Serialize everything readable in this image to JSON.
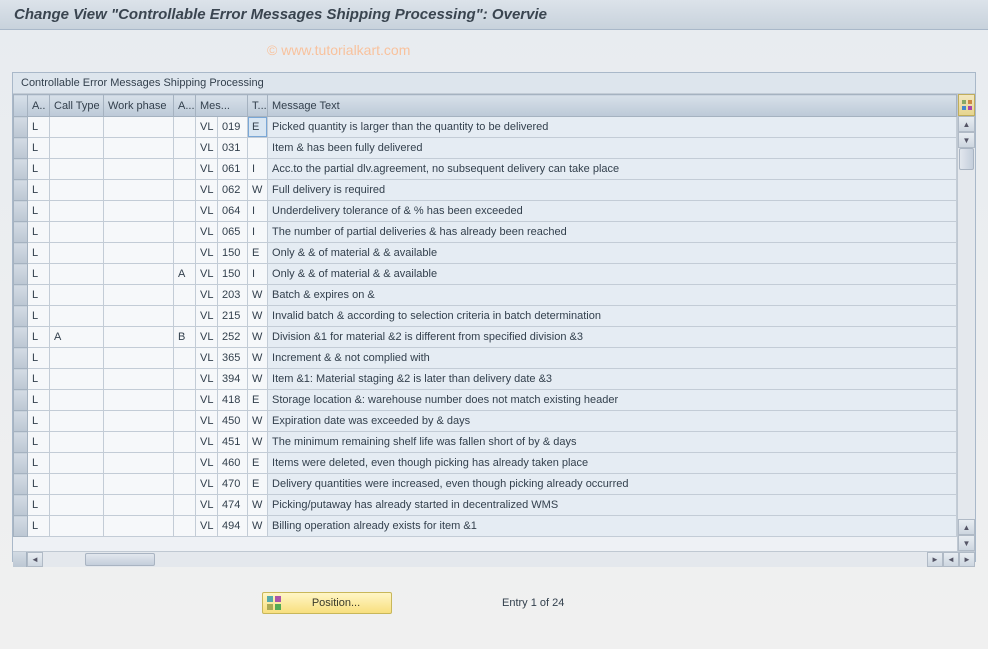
{
  "title": "Change View \"Controllable Error Messages Shipping Processing\": Overvie",
  "watermark": "© www.tutorialkart.com",
  "group_title": "Controllable Error Messages Shipping Processing",
  "columns": {
    "a1": "A..",
    "call_type": "Call Type",
    "work_phase": "Work phase",
    "a2": "A...",
    "mes_area": "Mes...",
    "t": "T...",
    "msg_text": "Message Text"
  },
  "rows": [
    {
      "a1": "L",
      "ct": "",
      "wp": "",
      "a2": "",
      "ma": "VL",
      "mn": "019",
      "t": "E",
      "txt": "Picked quantity is larger than the quantity to be delivered",
      "hl": true
    },
    {
      "a1": "L",
      "ct": "",
      "wp": "",
      "a2": "",
      "ma": "VL",
      "mn": "031",
      "t": "",
      "txt": "Item & has been fully delivered"
    },
    {
      "a1": "L",
      "ct": "",
      "wp": "",
      "a2": "",
      "ma": "VL",
      "mn": "061",
      "t": "I",
      "txt": "Acc.to the partial dlv.agreement, no subsequent delivery can take place"
    },
    {
      "a1": "L",
      "ct": "",
      "wp": "",
      "a2": "",
      "ma": "VL",
      "mn": "062",
      "t": "W",
      "txt": "Full delivery is required"
    },
    {
      "a1": "L",
      "ct": "",
      "wp": "",
      "a2": "",
      "ma": "VL",
      "mn": "064",
      "t": "I",
      "txt": "Underdelivery tolerance of & % has been exceeded"
    },
    {
      "a1": "L",
      "ct": "",
      "wp": "",
      "a2": "",
      "ma": "VL",
      "mn": "065",
      "t": "I",
      "txt": "The number of partial deliveries & has already been reached"
    },
    {
      "a1": "L",
      "ct": "",
      "wp": "",
      "a2": "",
      "ma": "VL",
      "mn": "150",
      "t": "E",
      "txt": "Only & & of material & & available"
    },
    {
      "a1": "L",
      "ct": "",
      "wp": "",
      "a2": "A",
      "ma": "VL",
      "mn": "150",
      "t": "I",
      "txt": "Only & & of material & & available"
    },
    {
      "a1": "L",
      "ct": "",
      "wp": "",
      "a2": "",
      "ma": "VL",
      "mn": "203",
      "t": "W",
      "txt": "Batch & expires on &"
    },
    {
      "a1": "L",
      "ct": "",
      "wp": "",
      "a2": "",
      "ma": "VL",
      "mn": "215",
      "t": "W",
      "txt": "Invalid batch & according to selection criteria in batch determination"
    },
    {
      "a1": "L",
      "ct": "A",
      "wp": "",
      "a2": "B",
      "ma": "VL",
      "mn": "252",
      "t": "W",
      "txt": "Division &1 for material &2 is different from specified division &3"
    },
    {
      "a1": "L",
      "ct": "",
      "wp": "",
      "a2": "",
      "ma": "VL",
      "mn": "365",
      "t": "W",
      "txt": "Increment & & not complied with"
    },
    {
      "a1": "L",
      "ct": "",
      "wp": "",
      "a2": "",
      "ma": "VL",
      "mn": "394",
      "t": "W",
      "txt": "Item &1: Material staging &2 is later than delivery date &3"
    },
    {
      "a1": "L",
      "ct": "",
      "wp": "",
      "a2": "",
      "ma": "VL",
      "mn": "418",
      "t": "E",
      "txt": "Storage location &: warehouse number does not match existing header"
    },
    {
      "a1": "L",
      "ct": "",
      "wp": "",
      "a2": "",
      "ma": "VL",
      "mn": "450",
      "t": "W",
      "txt": "Expiration date was exceeded by & days"
    },
    {
      "a1": "L",
      "ct": "",
      "wp": "",
      "a2": "",
      "ma": "VL",
      "mn": "451",
      "t": "W",
      "txt": "The minimum remaining shelf life was fallen short of by & days"
    },
    {
      "a1": "L",
      "ct": "",
      "wp": "",
      "a2": "",
      "ma": "VL",
      "mn": "460",
      "t": "E",
      "txt": "Items were deleted, even though picking has already taken place"
    },
    {
      "a1": "L",
      "ct": "",
      "wp": "",
      "a2": "",
      "ma": "VL",
      "mn": "470",
      "t": "E",
      "txt": "Delivery quantities were increased, even though picking already occurred"
    },
    {
      "a1": "L",
      "ct": "",
      "wp": "",
      "a2": "",
      "ma": "VL",
      "mn": "474",
      "t": "W",
      "txt": "Picking/putaway has already started in decentralized WMS"
    },
    {
      "a1": "L",
      "ct": "",
      "wp": "",
      "a2": "",
      "ma": "VL",
      "mn": "494",
      "t": "W",
      "txt": "Billing operation already exists for item &1"
    }
  ],
  "position_button": "Position...",
  "entry_text": "Entry 1 of 24"
}
